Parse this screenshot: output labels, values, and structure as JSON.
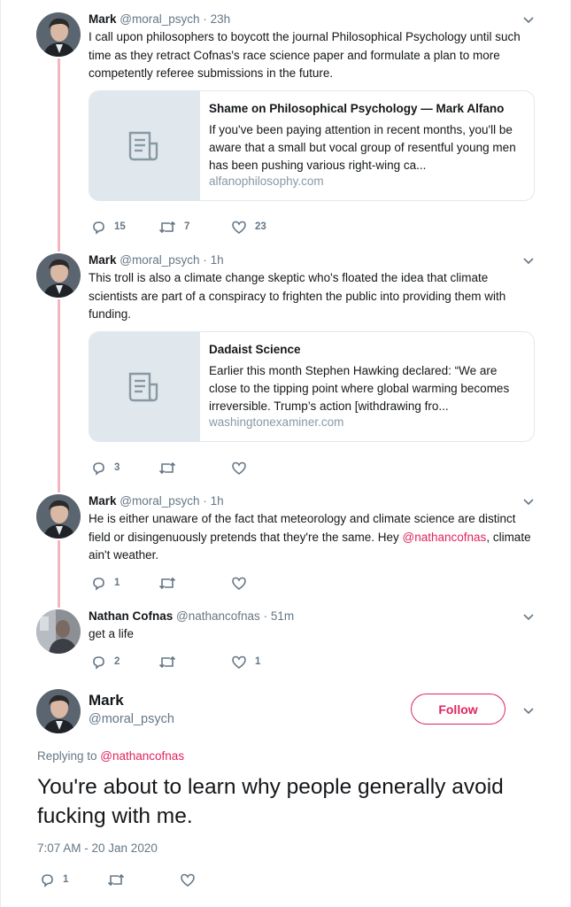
{
  "colors": {
    "accent": "#e0245e",
    "secondary_text": "#657786",
    "thread_line": "#f2b6c0",
    "border": "#e1e8ed"
  },
  "thread": [
    {
      "name": "Mark",
      "handle": "@moral_psych",
      "separator": "·",
      "time": "23h",
      "text": "I call upon philosophers to boycott the journal Philosophical Psychology until such time as they retract Cofnas's race science paper and formulate a plan to more competently referee submissions in the future.",
      "card": {
        "icon": "document-icon",
        "title": "Shame on Philosophical Psychology — Mark Alfano",
        "description": "If you've been paying attention in recent months, you'll be aware that a small but vocal group of resentful young men has been pushing various right-wing ca...",
        "domain": "alfanophilosophy.com"
      },
      "replies": "15",
      "retweets": "7",
      "likes": "23"
    },
    {
      "name": "Mark",
      "handle": "@moral_psych",
      "separator": "·",
      "time": "1h",
      "text": "This troll is also a climate change skeptic who's floated the idea that climate scientists are part of a conspiracy to frighten the public into providing them with funding.",
      "card": {
        "icon": "document-icon",
        "title": "Dadaist Science",
        "description": "Earlier this month Stephen Hawking declared: “We are close to the tipping point where global warming becomes irreversible. Trump’s action [withdrawing fro...",
        "domain": "washingtonexaminer.com"
      },
      "replies": "3",
      "retweets": "",
      "likes": ""
    },
    {
      "name": "Mark",
      "handle": "@moral_psych",
      "separator": "·",
      "time": "1h",
      "text_before": "He is either unaware of the fact that meteorology and climate science are distinct field or disingenuously pretends that they're the same. Hey ",
      "mention": "@nathancofnas",
      "text_after": ", climate ain't weather.",
      "replies": "1",
      "retweets": "",
      "likes": ""
    },
    {
      "name": "Nathan Cofnas",
      "handle": "@nathancofnas",
      "separator": "·",
      "time": "51m",
      "text": "get a life",
      "replies": "2",
      "retweets": "",
      "likes": "1"
    }
  ],
  "main_tweet": {
    "name": "Mark",
    "handle": "@moral_psych",
    "follow_label": "Follow",
    "replying_prefix": "Replying to ",
    "replying_to": "@nathancofnas",
    "text": "You're about to learn why people generally avoid fucking with me.",
    "timestamp": "7:07 AM - 20 Jan 2020",
    "replies": "1",
    "retweets": "",
    "likes": ""
  }
}
